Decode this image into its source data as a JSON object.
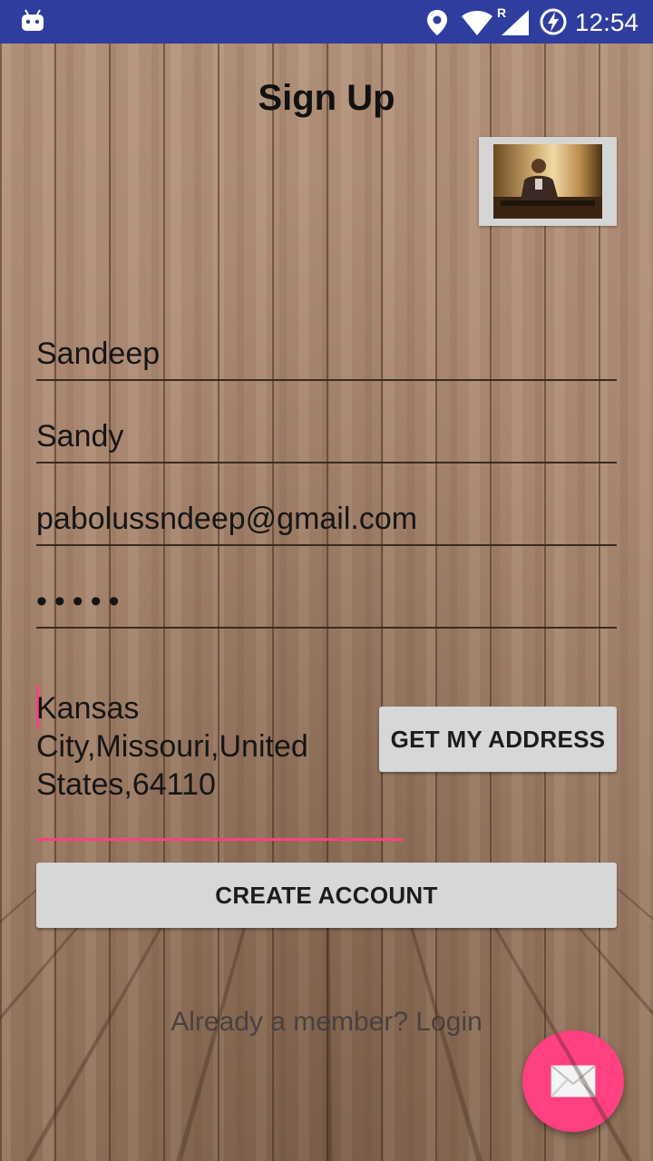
{
  "status_bar": {
    "time": "12:54",
    "icons": [
      "android-icon",
      "location-icon",
      "wifi-icon",
      "signal-icon",
      "battery-charging-icon"
    ],
    "roaming_label": "R"
  },
  "page": {
    "title": "Sign Up"
  },
  "form": {
    "first_name": "Sandeep",
    "nickname": "Sandy",
    "email": "pabolussndeep@gmail.com",
    "password_masked": "•••••",
    "address_line1": "Kansas",
    "address_line2": "City,Missouri,United",
    "address_line3": "States,64110"
  },
  "buttons": {
    "get_address": "GET MY ADDRESS",
    "create_account": "CREATE ACCOUNT"
  },
  "footer": {
    "login_link": "Already a member? Login"
  },
  "colors": {
    "status_bar": "#2f3e9e",
    "accent": "#ff4081",
    "button_bg": "#d6d7d7"
  }
}
